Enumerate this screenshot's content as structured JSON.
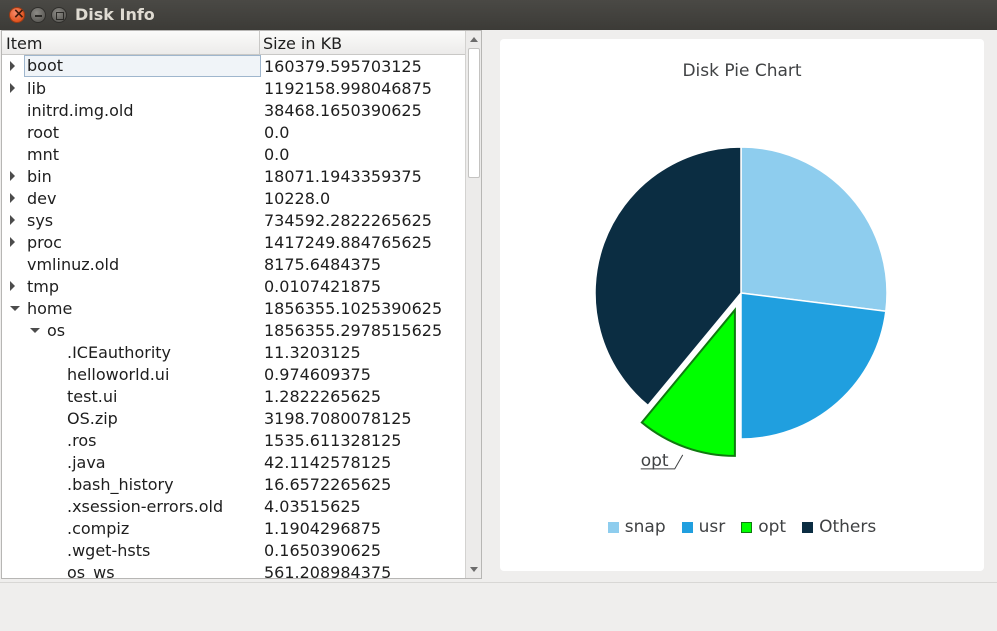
{
  "window": {
    "title": "Disk Info"
  },
  "tree": {
    "headers": {
      "item": "Item",
      "size": "Size in KB"
    },
    "rows": [
      {
        "name": "boot",
        "size": "160379.595703125",
        "depth": 0,
        "expander": "closed",
        "selected": true
      },
      {
        "name": "lib",
        "size": "1192158.998046875",
        "depth": 0,
        "expander": "closed"
      },
      {
        "name": "initrd.img.old",
        "size": "38468.1650390625",
        "depth": 0,
        "expander": "none"
      },
      {
        "name": "root",
        "size": "0.0",
        "depth": 0,
        "expander": "none"
      },
      {
        "name": "mnt",
        "size": "0.0",
        "depth": 0,
        "expander": "none"
      },
      {
        "name": "bin",
        "size": "18071.1943359375",
        "depth": 0,
        "expander": "closed"
      },
      {
        "name": "dev",
        "size": "10228.0",
        "depth": 0,
        "expander": "closed"
      },
      {
        "name": "sys",
        "size": "734592.2822265625",
        "depth": 0,
        "expander": "closed"
      },
      {
        "name": "proc",
        "size": "1417249.884765625",
        "depth": 0,
        "expander": "closed"
      },
      {
        "name": "vmlinuz.old",
        "size": "8175.6484375",
        "depth": 0,
        "expander": "none"
      },
      {
        "name": "tmp",
        "size": "0.0107421875",
        "depth": 0,
        "expander": "closed"
      },
      {
        "name": "home",
        "size": "1856355.1025390625",
        "depth": 0,
        "expander": "open"
      },
      {
        "name": "os",
        "size": "1856355.2978515625",
        "depth": 1,
        "expander": "open"
      },
      {
        "name": ".ICEauthority",
        "size": "11.3203125",
        "depth": 2,
        "expander": "none"
      },
      {
        "name": "helloworld.ui",
        "size": "0.974609375",
        "depth": 2,
        "expander": "none"
      },
      {
        "name": "test.ui",
        "size": "1.2822265625",
        "depth": 2,
        "expander": "none"
      },
      {
        "name": "OS.zip",
        "size": "3198.7080078125",
        "depth": 2,
        "expander": "none"
      },
      {
        "name": ".ros",
        "size": "1535.611328125",
        "depth": 2,
        "expander": "none"
      },
      {
        "name": ".java",
        "size": "42.1142578125",
        "depth": 2,
        "expander": "none"
      },
      {
        "name": ".bash_history",
        "size": "16.6572265625",
        "depth": 2,
        "expander": "none"
      },
      {
        "name": ".xsession-errors.old",
        "size": "4.03515625",
        "depth": 2,
        "expander": "none"
      },
      {
        "name": ".compiz",
        "size": "1.1904296875",
        "depth": 2,
        "expander": "none"
      },
      {
        "name": ".wget-hsts",
        "size": "0.1650390625",
        "depth": 2,
        "expander": "none"
      },
      {
        "name": "os_ws",
        "size": "561.208984375",
        "depth": 2,
        "expander": "none"
      }
    ]
  },
  "chart_data": {
    "type": "pie",
    "title": "Disk Pie Chart",
    "slices": [
      {
        "label": "snap",
        "value": 27,
        "color": "#8ecdee",
        "exploded": false,
        "show_label": false
      },
      {
        "label": "usr",
        "value": 23,
        "color": "#209fdf",
        "exploded": false,
        "show_label": false
      },
      {
        "label": "opt",
        "value": 11,
        "color": "#00ff00",
        "exploded": true,
        "show_label": true
      },
      {
        "label": "Others",
        "value": 39,
        "color": "#0b2d42",
        "exploded": false,
        "show_label": false
      }
    ],
    "legend_position": "bottom"
  }
}
